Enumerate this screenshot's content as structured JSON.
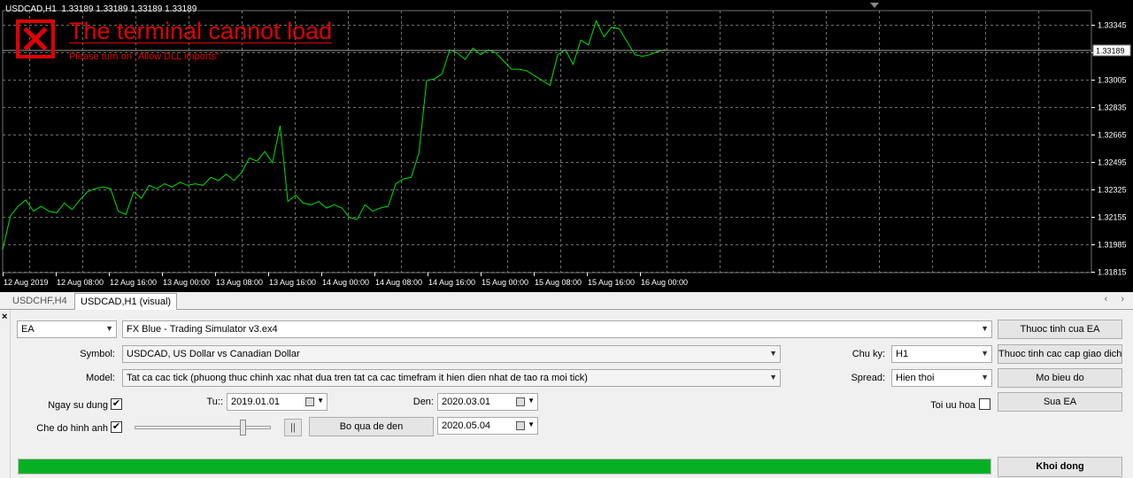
{
  "chart": {
    "header": "USDCAD,H1  1.33189 1.33189 1.33189 1.33189",
    "error_title": "The terminal cannot load",
    "error_subtitle": "Please turn on \"Allow DLL imports\"",
    "colors": {
      "background": "#000000",
      "line": "#00e000",
      "grid": "#707070",
      "error": "#e00000",
      "axis_text": "#ffffff"
    },
    "icons": [
      "error-x-icon"
    ]
  },
  "chart_data": {
    "type": "line",
    "ylim": [
      1.31815,
      1.33345
    ],
    "yticks": [
      "1.33345",
      "1.33175",
      "1.33005",
      "1.32835",
      "1.32665",
      "1.32495",
      "1.32325",
      "1.32155",
      "1.31985",
      "1.31815"
    ],
    "current_price_label": "1.33189",
    "xticks": [
      "12 Aug 2019",
      "12 Aug 08:00",
      "12 Aug 16:00",
      "13 Aug 00:00",
      "13 Aug 08:00",
      "13 Aug 16:00",
      "14 Aug 00:00",
      "14 Aug 08:00",
      "14 Aug 16:00",
      "15 Aug 00:00",
      "15 Aug 08:00",
      "15 Aug 16:00",
      "16 Aug 00:00"
    ],
    "grid": true,
    "series": [
      {
        "values": [
          1.3195,
          1.3216,
          1.3222,
          1.3226,
          1.3219,
          1.3222,
          1.3219,
          1.3218,
          1.3224,
          1.322,
          1.3226,
          1.3231,
          1.3233,
          1.3234,
          1.3233,
          1.3219,
          1.3217,
          1.3231,
          1.3227,
          1.3235,
          1.3233,
          1.3236,
          1.3234,
          1.3237,
          1.3235,
          1.3236,
          1.3235,
          1.324,
          1.3238,
          1.3242,
          1.3238,
          1.3243,
          1.3252,
          1.325,
          1.3256,
          1.3249,
          1.3272,
          1.3225,
          1.3229,
          1.3224,
          1.3223,
          1.3225,
          1.3221,
          1.3223,
          1.3221,
          1.3215,
          1.3214,
          1.3223,
          1.3219,
          1.3221,
          1.3222,
          1.3236,
          1.3239,
          1.324,
          1.3255,
          1.33,
          1.3301,
          1.3304,
          1.3319,
          1.3317,
          1.3313,
          1.332,
          1.3316,
          1.3319,
          1.3317,
          1.3312,
          1.3307,
          1.3307,
          1.3306,
          1.3303,
          1.33,
          1.3297,
          1.3316,
          1.3319,
          1.331,
          1.3325,
          1.3322,
          1.3337,
          1.3327,
          1.3333,
          1.3332,
          1.3324,
          1.3316,
          1.3315,
          1.3316,
          1.3318,
          1.3319
        ]
      }
    ]
  },
  "tabs": [
    {
      "label": "USDCHF,H4",
      "active": false
    },
    {
      "label": "USDCAD,H1 (visual)",
      "active": true
    }
  ],
  "tester": {
    "close_glyph": "×",
    "nav_arrows": "‹ ›",
    "mode": "EA",
    "expert": "FX Blue - Trading Simulator v3.ex4",
    "symbol_label": "Symbol:",
    "symbol": "USDCAD, US Dollar vs Canadian Dollar",
    "model_label": "Model:",
    "model": "Tat ca cac tick (phuong thuc chinh xac nhat dua tren tat ca cac timefram it hien dien nhat de tao ra moi tick)",
    "use_date_label": "Ngay su dung",
    "use_date_checked": true,
    "from_label": "Tu::",
    "from_date": "2019.01.01",
    "to_label": "Den:",
    "to_date": "2020.03.01",
    "visual_label": "Che do hinh anh",
    "visual_checked": true,
    "speed_value": 0.8,
    "pause_glyph": "||",
    "skip_button": "Bo qua de den",
    "skip_date": "2020.05.04",
    "period_label": "Chu ky:",
    "period": "H1",
    "spread_label": "Spread:",
    "spread": "Hien thoi",
    "optimize_label": "Toi uu hoa",
    "optimize_checked": false,
    "btn_expert_props": "Thuoc tinh cua EA",
    "btn_symbol_props": "Thuoc tinh cac cap giao dich",
    "btn_open_chart": "Mo bieu do",
    "btn_modify_ea": "Sua EA",
    "btn_start": "Khoi dong",
    "progress": 1.0,
    "progress_color": "#06b025",
    "check_glyph": "✔",
    "arrow_glyph": "▼"
  }
}
